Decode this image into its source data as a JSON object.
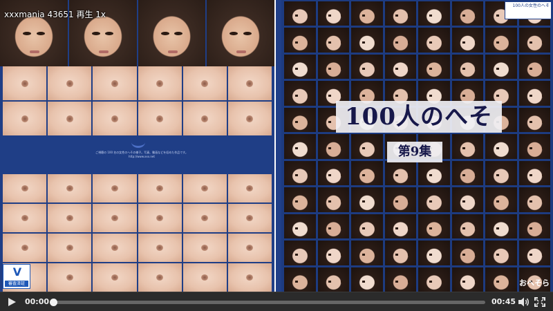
{
  "watermark": {
    "text": "xxxmania 43651 再生 1x"
  },
  "video": {
    "back_cover": {
      "description_text": "ご視聴の 100 名の女性のへその様子。写真、動画などを収めた作品です。",
      "url_text": "http://www.xxx.net",
      "rating_badge_mark": "V",
      "rating_badge_label": "審査済証"
    },
    "front_cover": {
      "title": "100人のへそ",
      "subtitle": "第9集",
      "corner_label": "100人の女性のへそ",
      "brand": "おへそら"
    }
  },
  "controls": {
    "current_time": "00:00",
    "duration": "00:45",
    "progress": 0,
    "icons": {
      "play": "play-icon",
      "volume": "volume-icon",
      "fullscreen": "fullscreen-icon"
    },
    "colors": {
      "bar_bg": "#2b2b2b",
      "track": "#666666",
      "handle": "#f2f2f2"
    }
  }
}
